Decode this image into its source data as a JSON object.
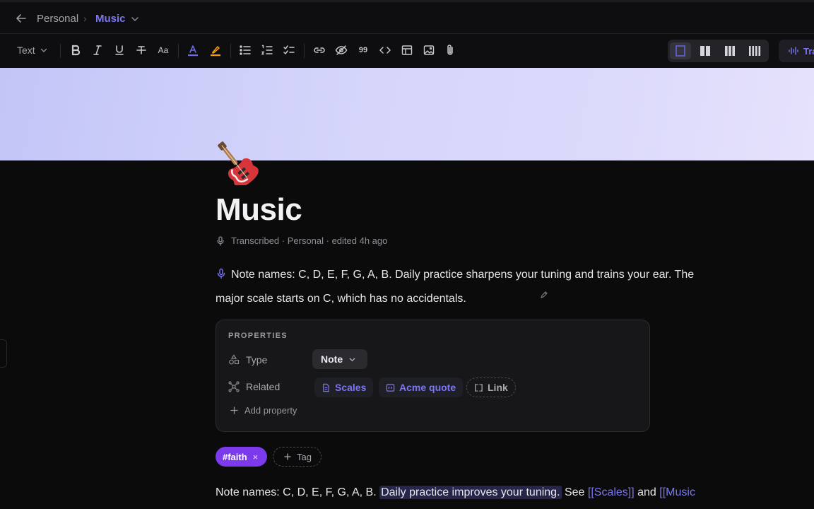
{
  "breadcrumb": {
    "parent": "Personal",
    "separator": "›",
    "current": "Music"
  },
  "toolbar": {
    "text_style": "Text",
    "quote_glyph": "99",
    "accent_text_underline": "#6e69ea",
    "highlight_underline": "#f59e0b",
    "transcribe_label": "Tra"
  },
  "page": {
    "emoji": "🎸",
    "title": "Music",
    "meta": "Transcribed · Personal · edited 4h ago",
    "paragraph": "Note names: C, D, E, F, G, A, B. Daily practice sharpens your tuning and trains your ear. The major scale starts on C, which has no accidentals."
  },
  "properties": {
    "heading": "PROPERTIES",
    "type_label": "Type",
    "type_value": "Note",
    "related_label": "Related",
    "related": [
      "Scales",
      "Acme quote"
    ],
    "link_label": "Link",
    "add_property": "Add property"
  },
  "tags": {
    "tag": "#faith",
    "remove": "×",
    "add_tag": "Tag"
  },
  "body2": {
    "plain": "Note names: C, D, E, F, G, A, B. ",
    "highlight": "Daily practice improves your tuning.",
    "see": " See ",
    "link1": "[[Scales]]",
    "and": " and ",
    "link2": "[[Music"
  },
  "colors": {
    "accent": "#7b76f0",
    "tag": "#7c3aed",
    "cover_start": "#c3c5f7",
    "cover_end": "#e6e2fd"
  }
}
